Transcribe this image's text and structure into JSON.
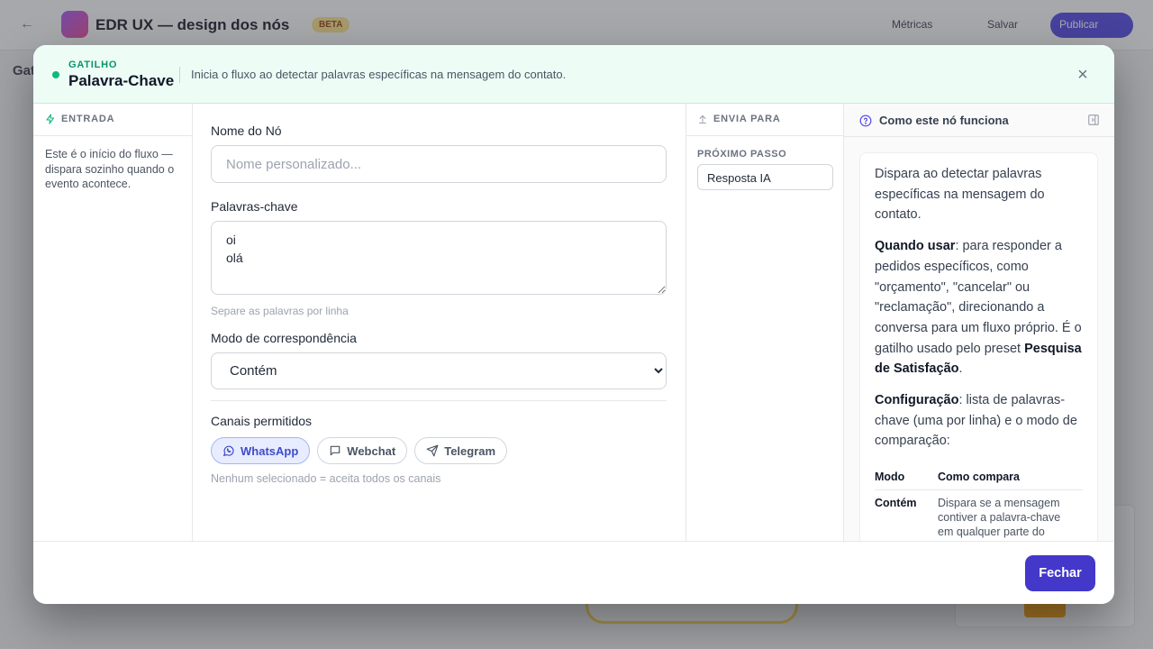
{
  "background": {
    "app_title": "EDR UX — design dos nós",
    "badge": "BETA",
    "btn_metrics": "Métricas",
    "btn_save": "Salvar",
    "btn_publish": "Publicar",
    "side_label": "Gat"
  },
  "modal": {
    "kicker": "GATILHO",
    "title": "Palavra-Chave",
    "description": "Inicia o fluxo ao detectar palavras específicas na mensagem do contato.",
    "close_symbol": "×"
  },
  "entrada": {
    "title": "ENTRADA",
    "text": "Este é o início do fluxo — dispara sozinho quando o evento acontece."
  },
  "form": {
    "name_label": "Nome do Nó",
    "name_value": "",
    "name_placeholder": "Nome personalizado...",
    "keywords_label": "Palavras-chave",
    "keywords_value": "oi\nolá",
    "keywords_hint": "Separe as palavras por linha",
    "match_label": "Modo de correspondência",
    "match_selected": "Contém",
    "channels_label": "Canais permitidos",
    "channels": [
      {
        "label": "WhatsApp",
        "active": true
      },
      {
        "label": "Webchat",
        "active": false
      },
      {
        "label": "Telegram",
        "active": false
      }
    ],
    "channels_hint": "Nenhum selecionado = aceita todos os canais"
  },
  "envia": {
    "title": "ENVIA PARA",
    "next_label": "PRÓXIMO PASSO",
    "next_value": "Resposta IA"
  },
  "help": {
    "title": "Como este nó funciona",
    "p1": "Dispara ao detectar palavras específicas na mensagem do contato.",
    "p2_bold": "Quando usar",
    "p2_text": ": para responder a pedidos específicos, como \"orçamento\", \"cancelar\" ou \"reclamação\", direcionando a conversa para um fluxo próprio. É o gatilho usado pelo preset ",
    "p2_bold2": "Pesquisa de Satisfação",
    "p2_end": ".",
    "p3_bold": "Configuração",
    "p3_text": ": lista de palavras-chave (uma por linha) e o modo de comparação:",
    "table_headers": [
      "Modo",
      "Como compara"
    ],
    "table_rows": [
      {
        "mode": "Contém",
        "desc": "Dispara se a mensagem contiver a palavra-chave em qualquer parte do"
      }
    ]
  },
  "footer": {
    "close_label": "Fechar"
  },
  "colors": {
    "accent": "#4338ca",
    "trigger_green": "#10b981",
    "header_bg": "#edfdf6"
  }
}
